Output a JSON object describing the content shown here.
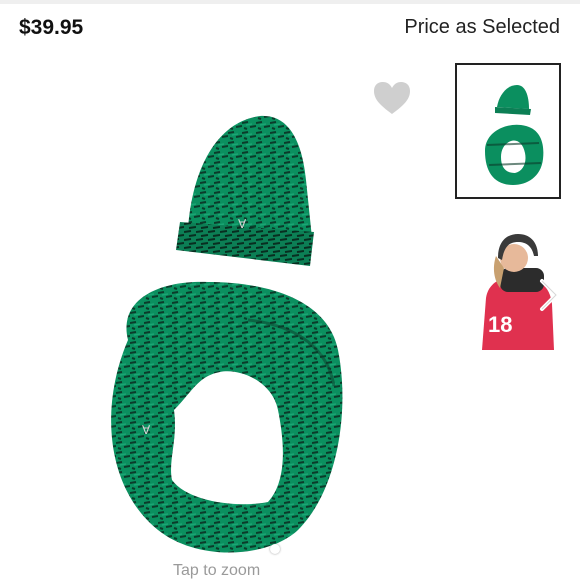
{
  "product": {
    "price": "$39.95",
    "price_note": "Price as Selected",
    "zoom_hint": "Tap to zoom"
  },
  "icons": {
    "favorite": "heart-icon",
    "next": "chevron-right-icon"
  },
  "colors": {
    "knit_green": "#0b8f5f",
    "knit_dark": "#0b3b2a",
    "heart_gray": "#cfcfcf"
  },
  "gallery": {
    "thumbnails": [
      {
        "label": "hat and scarf set",
        "selected": true
      },
      {
        "label": "model wearing set",
        "selected": false
      }
    ]
  }
}
